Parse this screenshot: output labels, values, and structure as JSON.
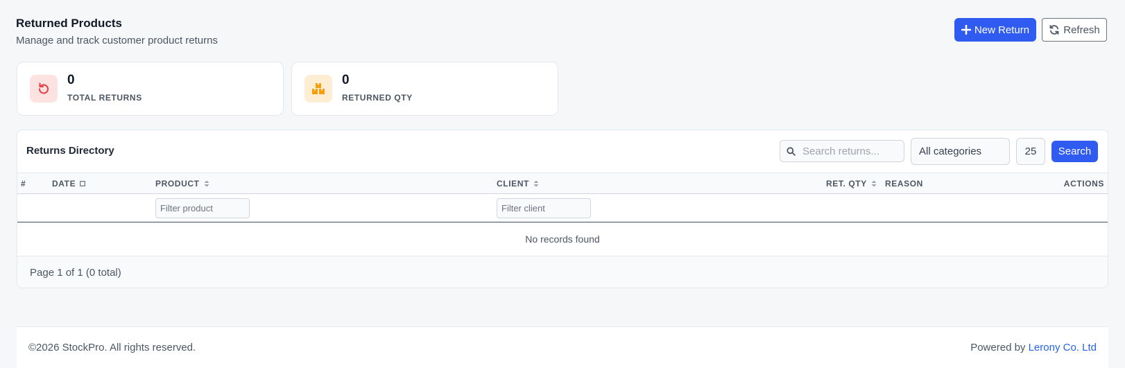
{
  "header": {
    "title": "Returned Products",
    "subtitle": "Manage and track customer product returns",
    "new_return_label": "New Return",
    "refresh_label": "Refresh"
  },
  "stats": [
    {
      "value": "0",
      "label": "TOTAL RETURNS",
      "icon": "undo-icon",
      "color": "#e5484d"
    },
    {
      "value": "0",
      "label": "RETURNED QTY",
      "icon": "boxes-icon",
      "color": "#f59e0b"
    }
  ],
  "directory": {
    "title": "Returns Directory",
    "search_placeholder": "Search returns...",
    "category_selected": "All categories",
    "page_size": "25",
    "search_label": "Search",
    "columns": [
      "#",
      "DATE",
      "PRODUCT",
      "CLIENT",
      "RET. QTY",
      "REASON",
      "ACTIONS"
    ],
    "filter_product_placeholder": "Filter product",
    "filter_client_placeholder": "Filter client",
    "empty_message": "No records found",
    "pagination": "Page 1 of 1 (0 total)"
  },
  "footer": {
    "copyright": "©2026 StockPro. All rights reserved.",
    "powered_by": "Powered by",
    "company": "Lerony Co. Ltd"
  },
  "colors": {
    "primary": "#2f5bf0",
    "link": "#2563eb"
  }
}
